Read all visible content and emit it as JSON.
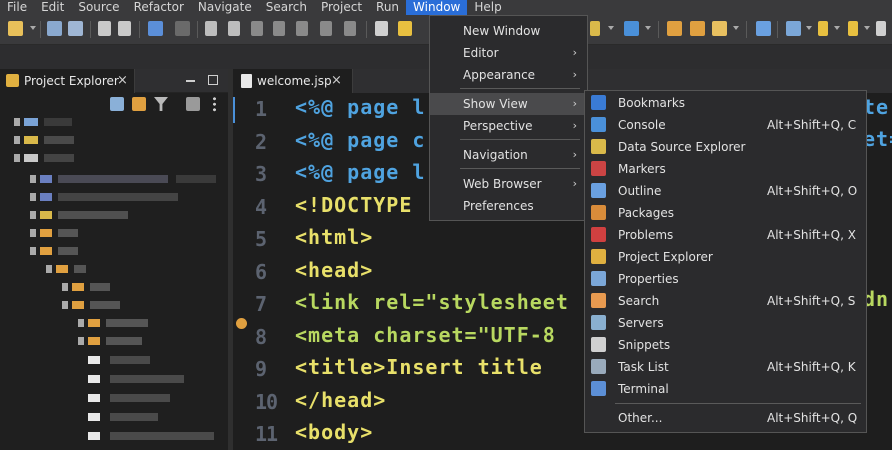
{
  "menubar": {
    "items": [
      "File",
      "Edit",
      "Source",
      "Refactor",
      "Navigate",
      "Search",
      "Project",
      "Run",
      "Window",
      "Help"
    ],
    "active": "Window"
  },
  "project_explorer": {
    "title": "Project Explorer",
    "close": "×"
  },
  "editor": {
    "tab_label": "welcome.jsp",
    "close": "×",
    "line_numbers": [
      "1",
      "2",
      "3",
      "4",
      "5",
      "6",
      "7",
      "8",
      "9",
      "10",
      "11"
    ],
    "lines": [
      "<%@ page l",
      "<%@ page c",
      "<%@ page l",
      "<!DOCTYPE",
      "<html>",
      "<head>",
      "<link rel=\"stylesheet",
      "<meta charset=\"UTF-8",
      "<title>Insert title",
      "</head>",
      "<body>"
    ],
    "right_fragments": [
      "te:",
      "et=",
      "dn"
    ]
  },
  "window_menu": {
    "items": [
      {
        "label": "New Window",
        "submenu": false
      },
      {
        "label": "Editor",
        "submenu": true
      },
      {
        "label": "Appearance",
        "submenu": true
      },
      {
        "label": "Show View",
        "submenu": true
      },
      {
        "label": "Perspective",
        "submenu": true
      },
      {
        "label": "Navigation",
        "submenu": true
      },
      {
        "label": "Web Browser",
        "submenu": true
      },
      {
        "label": "Preferences",
        "submenu": false
      }
    ],
    "arrow": "›"
  },
  "show_view_menu": {
    "items": [
      {
        "label": "Bookmarks",
        "shortcut": "",
        "icon": "bookmarks-icon",
        "color": "#3a7bd5"
      },
      {
        "label": "Console",
        "shortcut": "Alt+Shift+Q, C",
        "icon": "console-icon",
        "color": "#4a90d9"
      },
      {
        "label": "Data Source Explorer",
        "shortcut": "",
        "icon": "data-source-icon",
        "color": "#d9b94a"
      },
      {
        "label": "Markers",
        "shortcut": "",
        "icon": "markers-icon",
        "color": "#c44"
      },
      {
        "label": "Outline",
        "shortcut": "Alt+Shift+Q, O",
        "icon": "outline-icon",
        "color": "#6aa0e0"
      },
      {
        "label": "Packages",
        "shortcut": "",
        "icon": "packages-icon",
        "color": "#d98c3a"
      },
      {
        "label": "Problems",
        "shortcut": "Alt+Shift+Q, X",
        "icon": "problems-icon",
        "color": "#d04040"
      },
      {
        "label": "Project Explorer",
        "shortcut": "",
        "icon": "project-explorer-icon",
        "color": "#e0b040"
      },
      {
        "label": "Properties",
        "shortcut": "",
        "icon": "properties-icon",
        "color": "#7ba7d8"
      },
      {
        "label": "Search",
        "shortcut": "Alt+Shift+Q, S",
        "icon": "search-icon",
        "color": "#e89a50"
      },
      {
        "label": "Servers",
        "shortcut": "",
        "icon": "servers-icon",
        "color": "#8ab0d0"
      },
      {
        "label": "Snippets",
        "shortcut": "",
        "icon": "snippets-icon",
        "color": "#d0d0d0"
      },
      {
        "label": "Task List",
        "shortcut": "Alt+Shift+Q, K",
        "icon": "task-list-icon",
        "color": "#9ab"
      },
      {
        "label": "Terminal",
        "shortcut": "",
        "icon": "terminal-icon",
        "color": "#5c8fd6"
      },
      {
        "label": "Other...",
        "shortcut": "Alt+Shift+Q, Q",
        "icon": "",
        "color": ""
      }
    ]
  }
}
